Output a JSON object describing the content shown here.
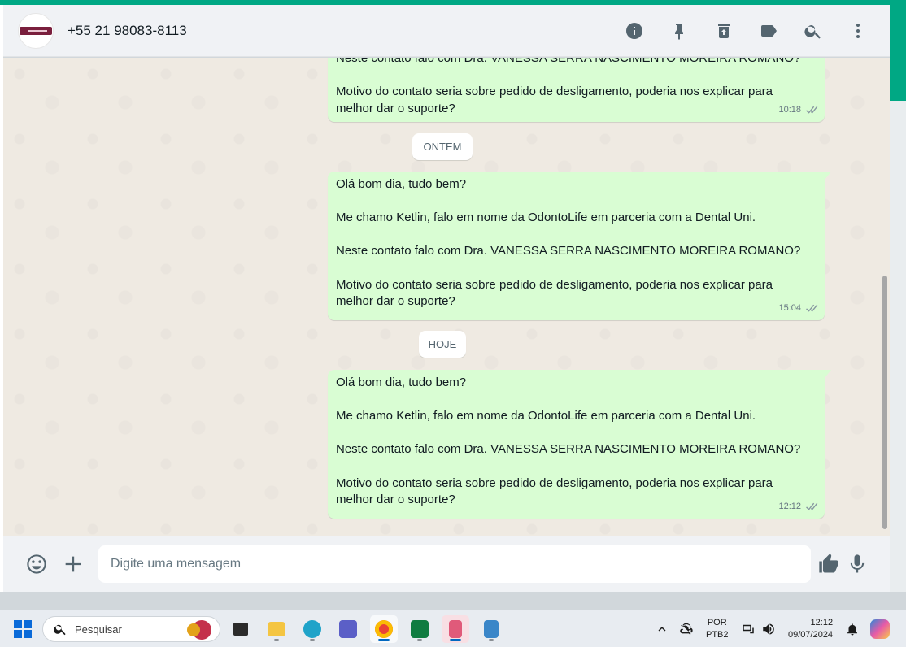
{
  "header": {
    "contact_name": "+55 21 98083-8113",
    "icons": [
      "info-icon",
      "pin-icon",
      "delete-icon",
      "label-icon",
      "search-icon",
      "menu-icon"
    ]
  },
  "messages": [
    {
      "partial_top": "Neste contato falo com Dra. VANESSA SERRA NASCIMENTO MOREIRA ROMANO?",
      "lines": [
        "Motivo do contato seria sobre pedido de desligamento, poderia nos explicar para",
        "melhor dar o suporte?"
      ],
      "time": "10:18"
    },
    {
      "date_chip": "ONTEM",
      "l1": "Olá bom dia, tudo bem?",
      "l2": "Me chamo Ketlin, falo em nome da OdontoLife em parceria com a Dental Uni.",
      "l3": "Neste contato falo com Dra. VANESSA SERRA NASCIMENTO MOREIRA ROMANO?",
      "l4": "Motivo do contato seria sobre pedido de desligamento, poderia nos explicar para",
      "l5": "melhor dar o suporte?",
      "time": "15:04"
    },
    {
      "date_chip": "HOJE",
      "l1": "Olá bom dia, tudo bem?",
      "l2": "Me chamo Ketlin, falo em nome da OdontoLife em parceria com a Dental Uni.",
      "l3": "Neste contato falo com Dra. VANESSA SERRA NASCIMENTO MOREIRA ROMANO?",
      "l4": "Motivo do contato seria sobre pedido de desligamento, poderia nos explicar para",
      "l5": "melhor dar o suporte?",
      "time": "12:12"
    }
  ],
  "composer": {
    "placeholder": "Digite uma mensagem",
    "icons": [
      "emoji-icon",
      "plus-icon",
      "thumbs-up-icon",
      "microphone-icon"
    ]
  },
  "taskbar": {
    "search_label": "Pesquisar",
    "apps": [
      "task-view",
      "file-explorer",
      "edge",
      "teams",
      "chrome",
      "excel",
      "snipping-tool",
      "notepad"
    ],
    "lang_top": "POR",
    "lang_bottom": "PTB2",
    "time": "12:12",
    "date": "09/07/2024"
  },
  "colors": {
    "accent": "#00a884",
    "outgoing_bubble": "#d9fdd3",
    "chat_background": "#efeae2",
    "header_background": "#f0f2f5"
  }
}
